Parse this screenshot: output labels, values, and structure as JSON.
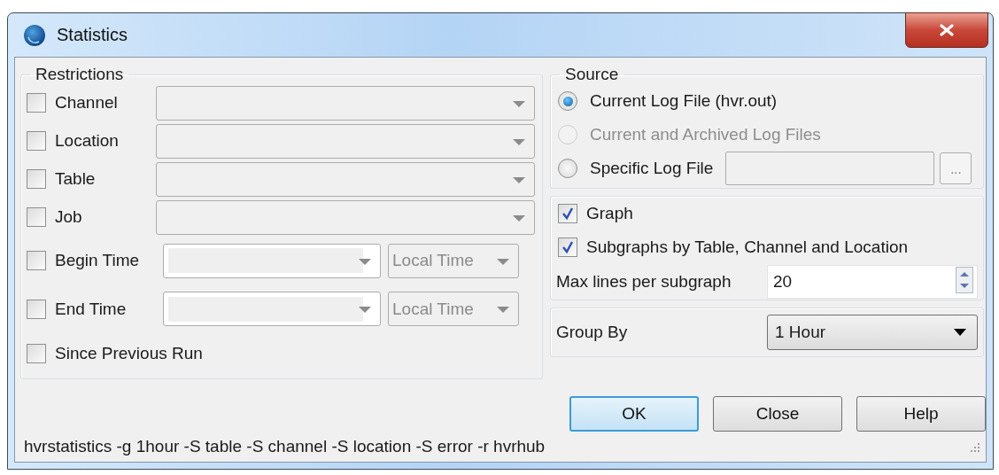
{
  "window": {
    "title": "Statistics"
  },
  "restrictions": {
    "title": "Restrictions",
    "filters": [
      {
        "label": "Channel",
        "checked": false,
        "kind": "combo"
      },
      {
        "label": "Location",
        "checked": false,
        "kind": "combo"
      },
      {
        "label": "Table",
        "checked": false,
        "kind": "combo"
      },
      {
        "label": "Job",
        "checked": false,
        "kind": "combo"
      },
      {
        "label": "Begin Time",
        "checked": false,
        "kind": "time",
        "timezone": "Local Time"
      },
      {
        "label": "End Time",
        "checked": false,
        "kind": "time",
        "timezone": "Local Time"
      },
      {
        "label": "Since Previous Run",
        "checked": false,
        "kind": "check"
      }
    ]
  },
  "source": {
    "title": "Source",
    "options": [
      {
        "label": "Current Log File (hvr.out)",
        "selected": true,
        "disabled": false
      },
      {
        "label": "Current and Archived Log Files",
        "selected": false,
        "disabled": true
      },
      {
        "label": "Specific Log File",
        "selected": false,
        "disabled": false
      }
    ],
    "browse_button": "..."
  },
  "graph": {
    "options": [
      {
        "label": "Graph",
        "checked": true
      },
      {
        "label": "Subgraphs by Table, Channel and Location",
        "checked": true
      }
    ],
    "max_lines": {
      "label": "Max lines per subgraph",
      "value": "20"
    }
  },
  "group_by": {
    "label": "Group By",
    "value": "1 Hour"
  },
  "buttons": [
    {
      "label": "OK",
      "default": true
    },
    {
      "label": "Close",
      "default": false
    },
    {
      "label": "Help",
      "default": false
    }
  ],
  "status_bar": "hvrstatistics -g 1hour -S table -S channel -S location -S error -r hvrhub"
}
